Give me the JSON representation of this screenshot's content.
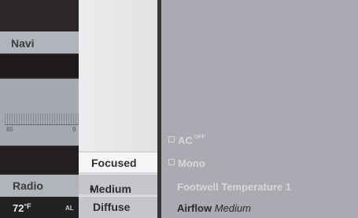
{
  "left_panel": {
    "nav_tab": "Navi",
    "scale": {
      "left_label": "85",
      "right_label": "9"
    },
    "radio_tab": "Radio",
    "temperature": {
      "value": "72",
      "unit": "°F",
      "mode": "AL"
    }
  },
  "popup": {
    "options": [
      {
        "label": "Focused",
        "selected": false
      },
      {
        "label": "Medium",
        "selected": true,
        "marker": "•"
      },
      {
        "label": "Diffuse",
        "selected": false
      }
    ]
  },
  "right_panel": {
    "ac": {
      "label": "AC",
      "superscript": "OFF"
    },
    "mono": {
      "label": "Mono"
    },
    "footwell": "Footwell Temperature  1",
    "airflow": {
      "label": "Airflow",
      "value": "Medium"
    }
  },
  "colors": {
    "background": "#a9aab2",
    "dark": "#2b2728",
    "popup": "#e4e4e6",
    "highlight": "#f6f6f7",
    "text_dark": "#2e2e32",
    "text_light": "#d6d7dc"
  },
  "icons": {
    "ac_checkbox": "checkbox-icon",
    "mono_checkbox": "checkbox-icon"
  }
}
